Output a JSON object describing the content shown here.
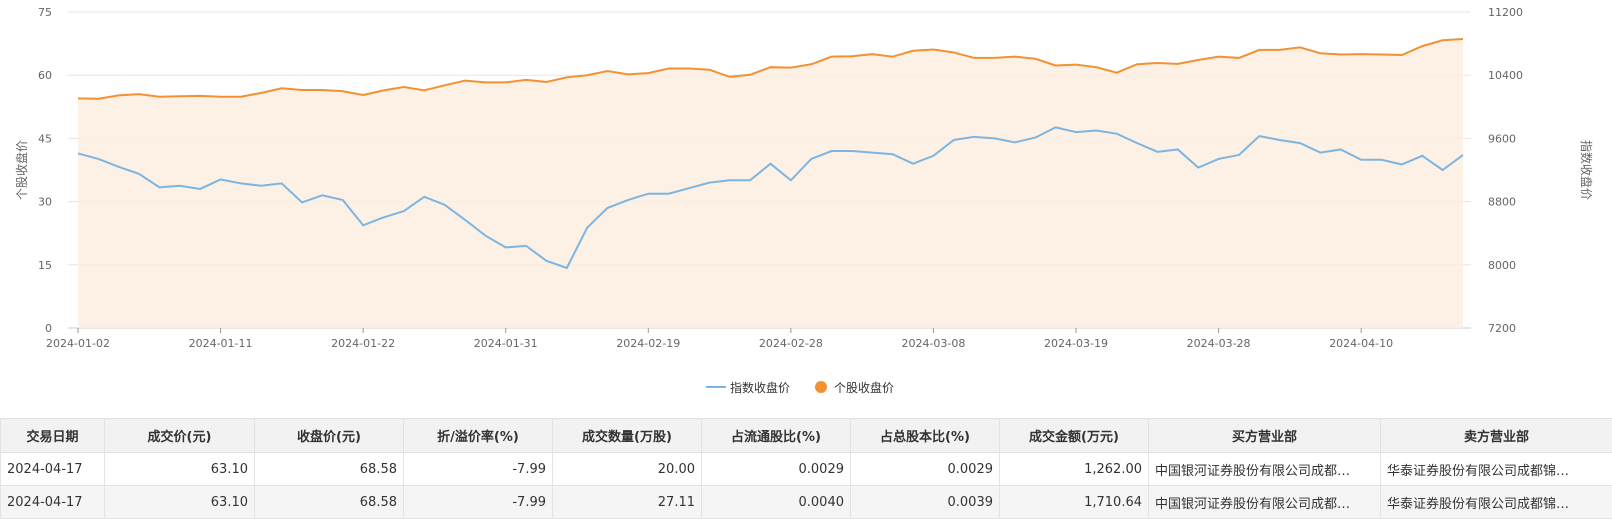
{
  "chart_data": {
    "type": "line",
    "x": [
      "2024-01-02",
      "2024-01-03",
      "2024-01-04",
      "2024-01-05",
      "2024-01-08",
      "2024-01-09",
      "2024-01-10",
      "2024-01-11",
      "2024-01-12",
      "2024-01-15",
      "2024-01-16",
      "2024-01-17",
      "2024-01-18",
      "2024-01-19",
      "2024-01-22",
      "2024-01-23",
      "2024-01-24",
      "2024-01-25",
      "2024-01-26",
      "2024-01-29",
      "2024-01-30",
      "2024-01-31",
      "2024-02-01",
      "2024-02-02",
      "2024-02-05",
      "2024-02-06",
      "2024-02-07",
      "2024-02-08",
      "2024-02-19",
      "2024-02-20",
      "2024-02-21",
      "2024-02-22",
      "2024-02-23",
      "2024-02-26",
      "2024-02-27",
      "2024-02-28",
      "2024-02-29",
      "2024-03-01",
      "2024-03-04",
      "2024-03-05",
      "2024-03-06",
      "2024-03-07",
      "2024-03-08",
      "2024-03-11",
      "2024-03-12",
      "2024-03-13",
      "2024-03-14",
      "2024-03-15",
      "2024-03-18",
      "2024-03-19",
      "2024-03-20",
      "2024-03-21",
      "2024-03-22",
      "2024-03-25",
      "2024-03-26",
      "2024-03-27",
      "2024-03-28",
      "2024-03-29",
      "2024-04-01",
      "2024-04-02",
      "2024-04-03",
      "2024-04-08",
      "2024-04-09",
      "2024-04-10",
      "2024-04-11",
      "2024-04-12",
      "2024-04-15",
      "2024-04-16",
      "2024-04-17"
    ],
    "x_ticks": [
      "2024-01-02",
      "2024-01-11",
      "2024-01-22",
      "2024-01-31",
      "2024-02-19",
      "2024-02-28",
      "2024-03-08",
      "2024-03-19",
      "2024-03-28",
      "2024-04-10"
    ],
    "y_left": {
      "label": "个股收盘价",
      "min": 0,
      "max": 75,
      "ticks": [
        "0",
        "15",
        "30",
        "45",
        "60",
        "75"
      ]
    },
    "y_right": {
      "label": "指数收盘价",
      "min": 7200,
      "max": 11200,
      "ticks": [
        "7200",
        "8000",
        "8800",
        "9600",
        "10400",
        "11200"
      ]
    },
    "series": [
      {
        "name": "指数收盘价",
        "axis": "right",
        "color": "#7cb5e2",
        "values": [
          9410,
          9340,
          9240,
          9150,
          8980,
          9000,
          8960,
          9080,
          9030,
          9000,
          9030,
          8790,
          8880,
          8820,
          8500,
          8600,
          8680,
          8860,
          8760,
          8570,
          8370,
          8220,
          8240,
          8050,
          7960,
          8470,
          8720,
          8820,
          8900,
          8900,
          8970,
          9040,
          9070,
          9070,
          9280,
          9070,
          9340,
          9440,
          9440,
          9420,
          9400,
          9280,
          9380,
          9580,
          9620,
          9600,
          9550,
          9610,
          9740,
          9680,
          9700,
          9660,
          9540,
          9430,
          9460,
          9230,
          9340,
          9390,
          9630,
          9580,
          9540,
          9420,
          9460,
          9330,
          9330,
          9270,
          9380,
          9200,
          9390
        ]
      },
      {
        "name": "个股收盘价",
        "axis": "left",
        "color": "#f39132",
        "values": [
          54.5,
          54.4,
          55.2,
          55.5,
          54.9,
          55.0,
          55.1,
          54.9,
          54.9,
          55.8,
          56.9,
          56.5,
          56.5,
          56.2,
          55.3,
          56.4,
          57.2,
          56.4,
          57.6,
          58.7,
          58.3,
          58.3,
          58.9,
          58.4,
          59.5,
          60.0,
          61.0,
          60.2,
          60.5,
          61.6,
          61.6,
          61.3,
          59.6,
          60.1,
          61.9,
          61.8,
          62.6,
          64.4,
          64.5,
          65.0,
          64.4,
          65.8,
          66.1,
          65.4,
          64.1,
          64.1,
          64.4,
          63.9,
          62.3,
          62.5,
          61.9,
          60.6,
          62.6,
          62.9,
          62.7,
          63.6,
          64.4,
          64.1,
          66.0,
          66.0,
          66.6,
          65.2,
          64.9,
          65.0,
          64.9,
          64.8,
          66.9,
          68.3,
          68.58
        ]
      }
    ],
    "legend": {
      "placement": "bottom-center"
    },
    "grid": true
  },
  "table": {
    "headers": [
      "交易日期",
      "成交价(元)",
      "收盘价(元)",
      "折/溢价率(%)",
      "成交数量(万股)",
      "占流通股比(%)",
      "占总股本比(%)",
      "成交金额(万元)",
      "买方营业部",
      "卖方营业部"
    ],
    "rows": [
      [
        "2024-04-17",
        "63.10",
        "68.58",
        "-7.99",
        "20.00",
        "0.0029",
        "0.0029",
        "1,262.00",
        "中国银河证券股份有限公司成都…",
        "华泰证券股份有限公司成都锦…"
      ],
      [
        "2024-04-17",
        "63.10",
        "68.58",
        "-7.99",
        "27.11",
        "0.0040",
        "0.0039",
        "1,710.64",
        "中国银河证券股份有限公司成都…",
        "华泰证券股份有限公司成都锦…"
      ]
    ]
  }
}
